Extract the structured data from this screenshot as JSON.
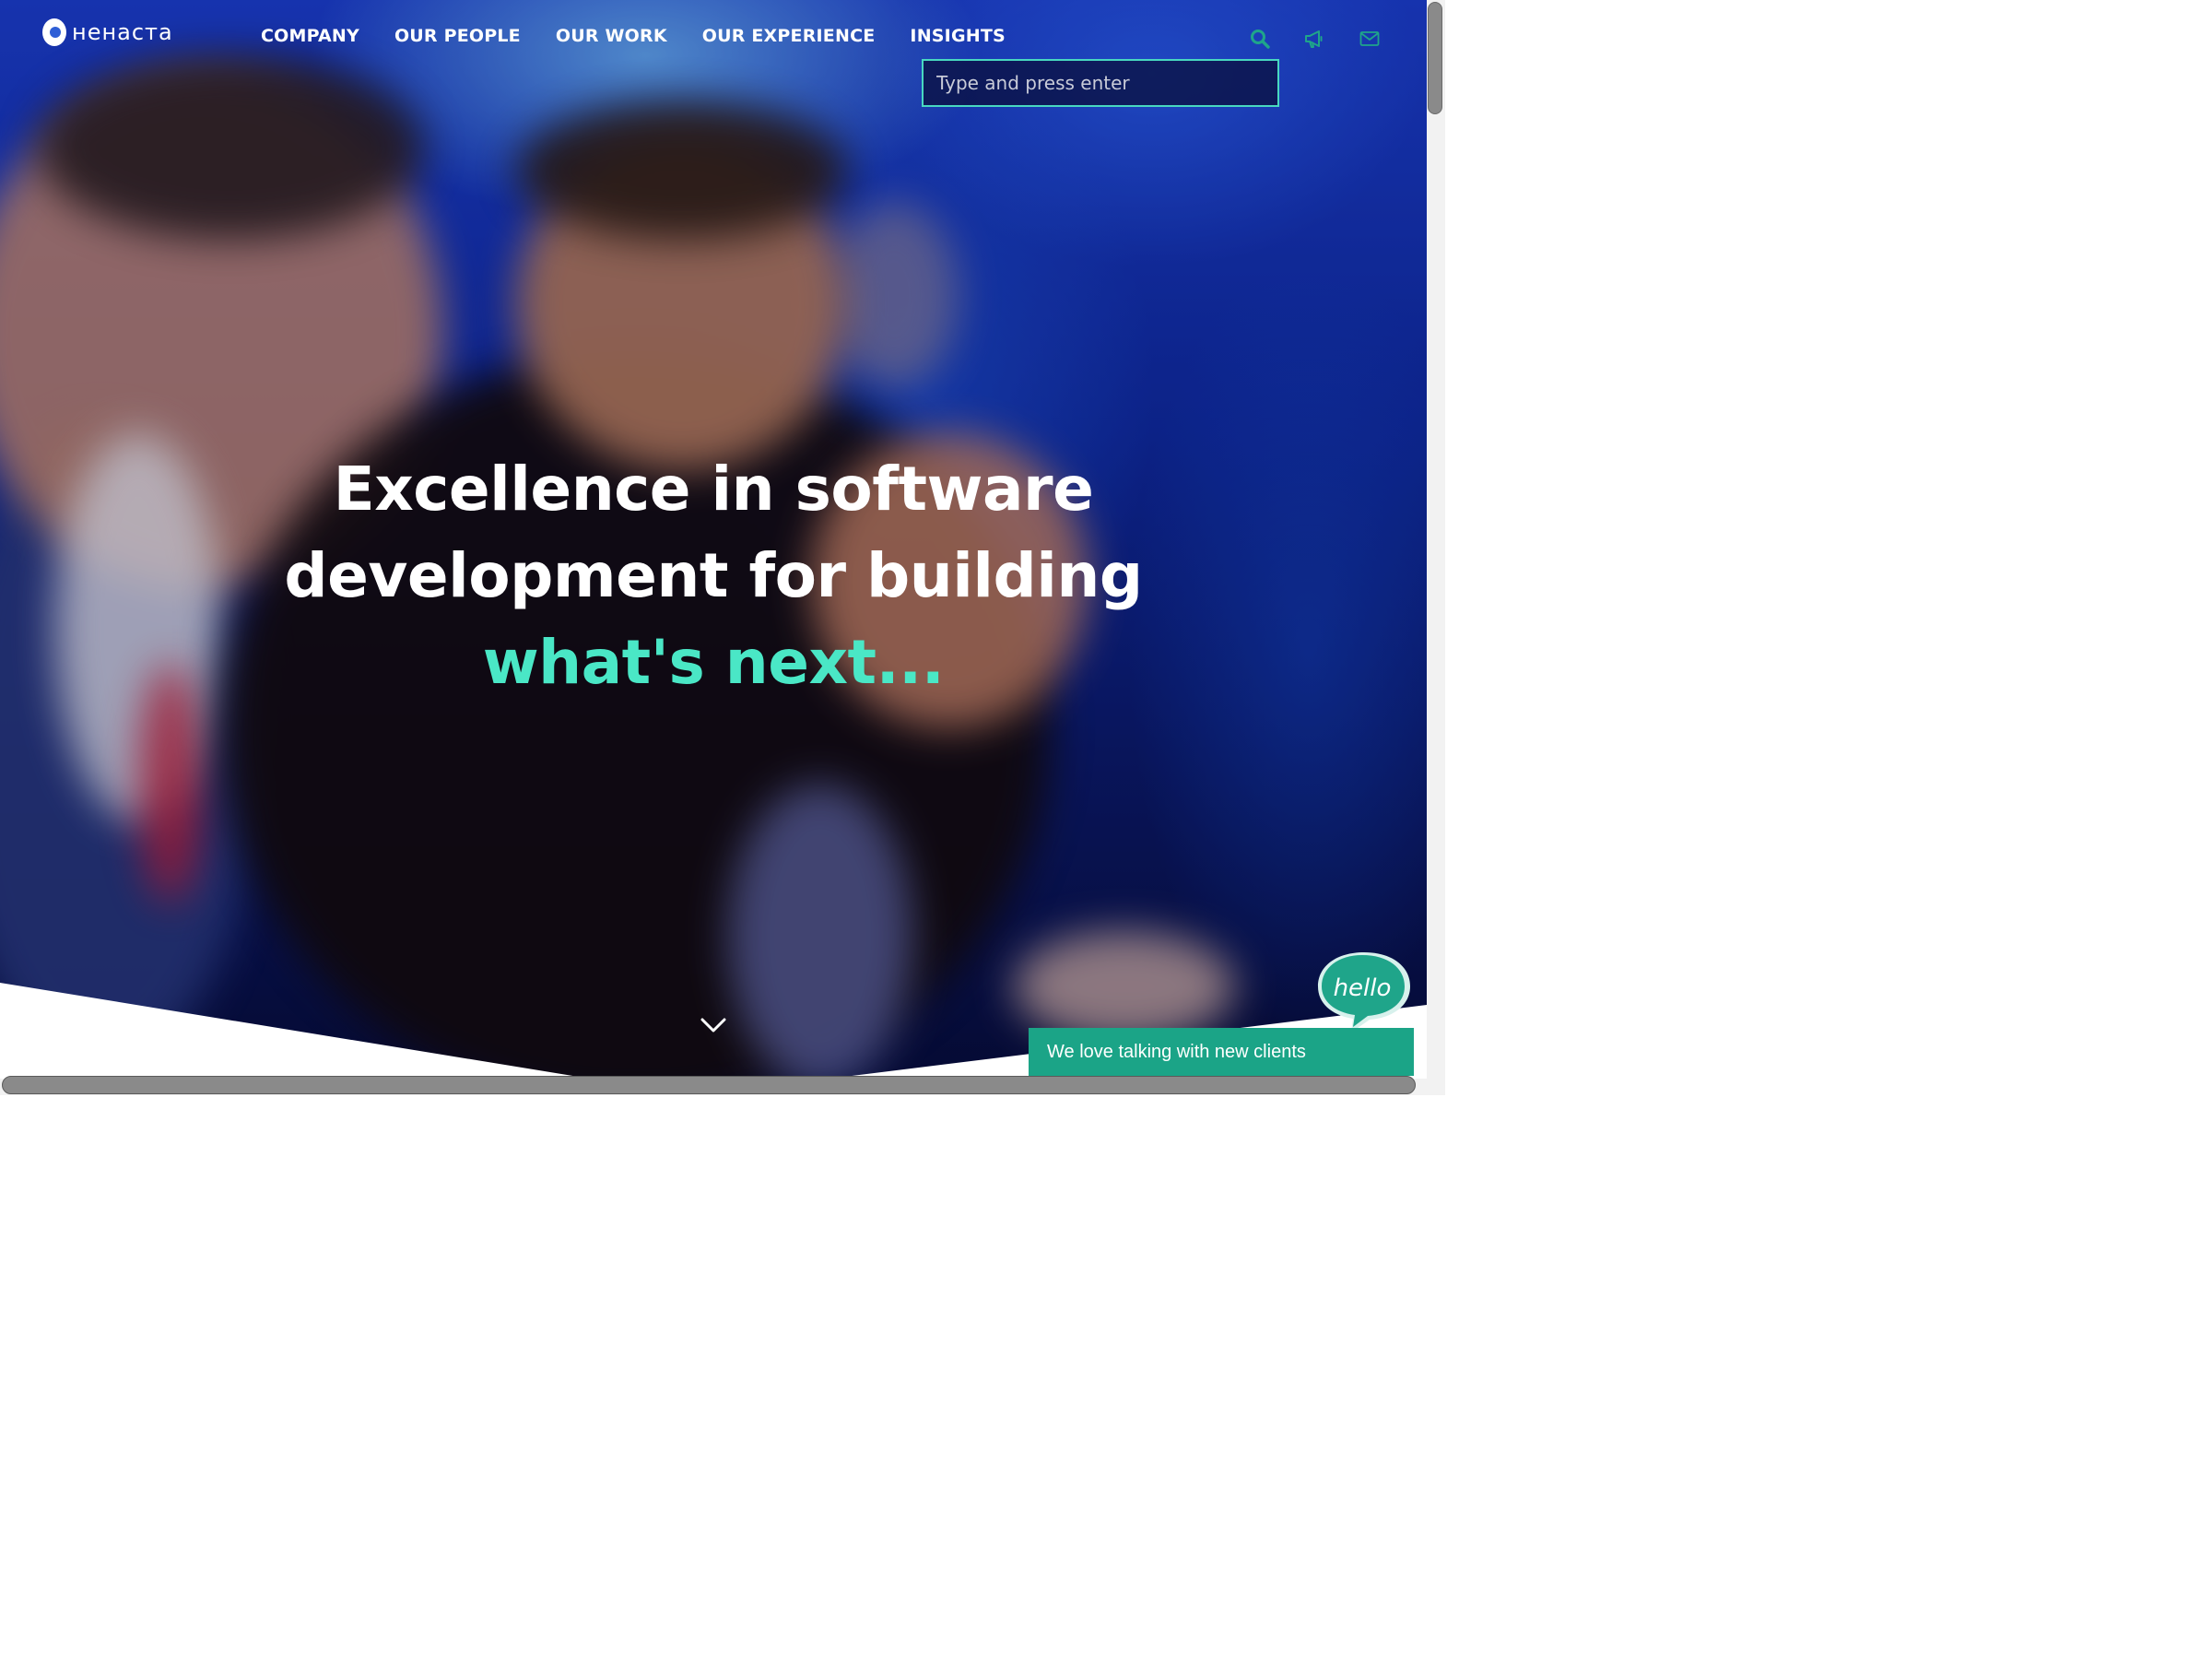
{
  "brand": {
    "logo_text": "нeнacтa"
  },
  "nav": {
    "items": [
      {
        "label": "COMPANY"
      },
      {
        "label": "OUR PEOPLE"
      },
      {
        "label": "OUR WORK"
      },
      {
        "label": "OUR EXPERIENCE"
      },
      {
        "label": "INSIGHTS"
      }
    ]
  },
  "header_icons": {
    "search": "search-icon",
    "news": "megaphone-icon",
    "contact": "envelope-icon",
    "color": "#1fa58a"
  },
  "search": {
    "placeholder": "Type and press enter",
    "value": ""
  },
  "hero": {
    "headline_line1": "Excellence in software",
    "headline_line2": "development for building",
    "headline_accent": "what's next...",
    "accent_color": "#4ae7c6"
  },
  "chat": {
    "bubble_text": "hello",
    "bar_text": "We love talking with new clients",
    "color": "#1ba487"
  }
}
